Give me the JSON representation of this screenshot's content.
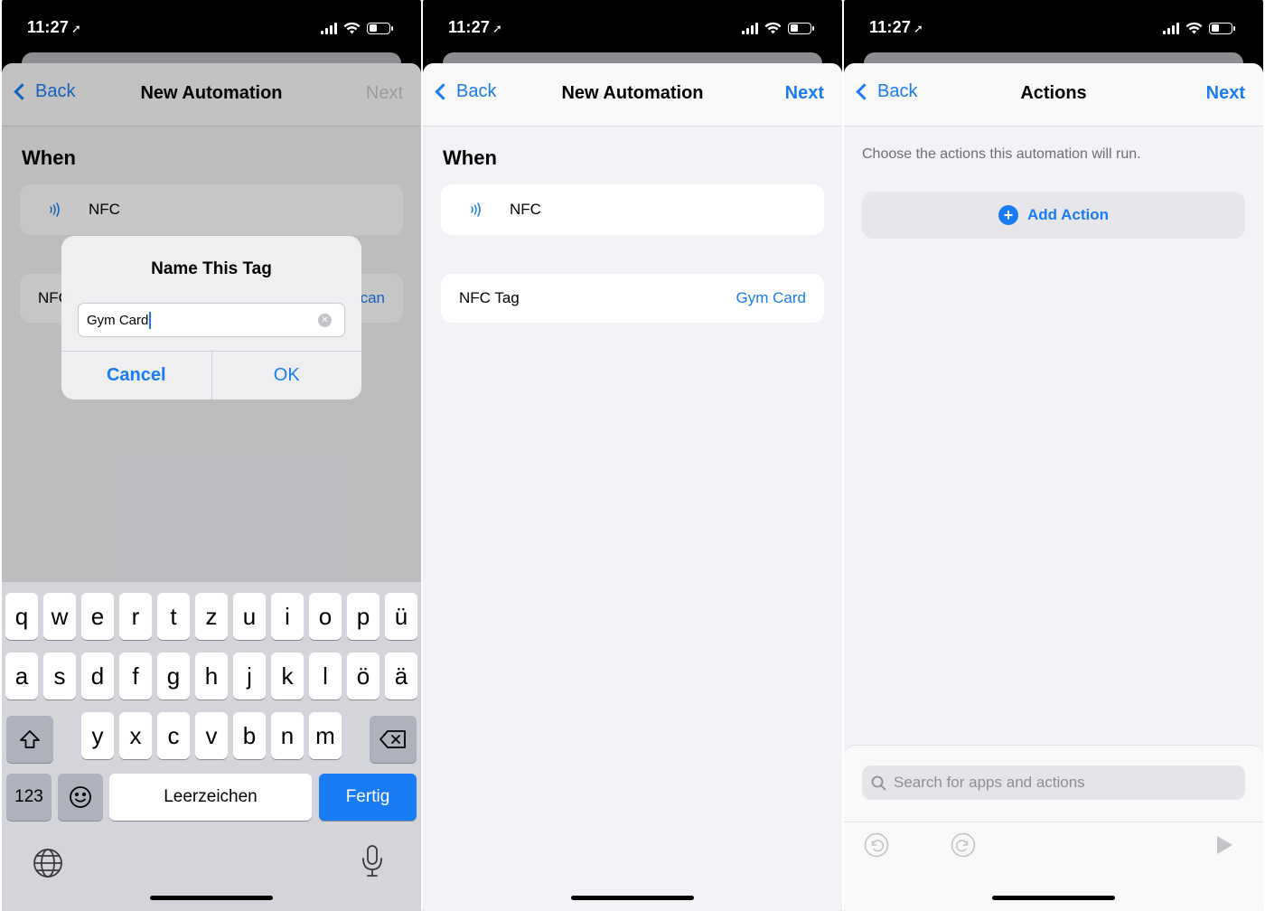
{
  "status": {
    "time": "11:27"
  },
  "nav": {
    "back": "Back",
    "next": "Next"
  },
  "screen1": {
    "title": "New Automation",
    "section": "When",
    "trigger": "NFC",
    "partial_row_label": "NFC",
    "partial_row_value": "can",
    "alert": {
      "title": "Name This Tag",
      "value": "Gym Card",
      "cancel": "Cancel",
      "ok": "OK"
    },
    "keyboard": {
      "row1": [
        "q",
        "w",
        "e",
        "r",
        "t",
        "z",
        "u",
        "i",
        "o",
        "p",
        "ü"
      ],
      "row2": [
        "a",
        "s",
        "d",
        "f",
        "g",
        "h",
        "j",
        "k",
        "l",
        "ö",
        "ä"
      ],
      "row3": [
        "y",
        "x",
        "c",
        "v",
        "b",
        "n",
        "m"
      ],
      "numbers": "123",
      "space": "Leerzeichen",
      "done": "Fertig"
    }
  },
  "screen2": {
    "title": "New Automation",
    "section": "When",
    "trigger": "NFC",
    "tag_label": "NFC Tag",
    "tag_value": "Gym Card"
  },
  "screen3": {
    "title": "Actions",
    "hint": "Choose the actions this automation will run.",
    "add_action": "Add Action",
    "search_placeholder": "Search for apps and actions"
  },
  "colors": {
    "accent": "#1a7cf5",
    "background": "#f2f2f7"
  }
}
